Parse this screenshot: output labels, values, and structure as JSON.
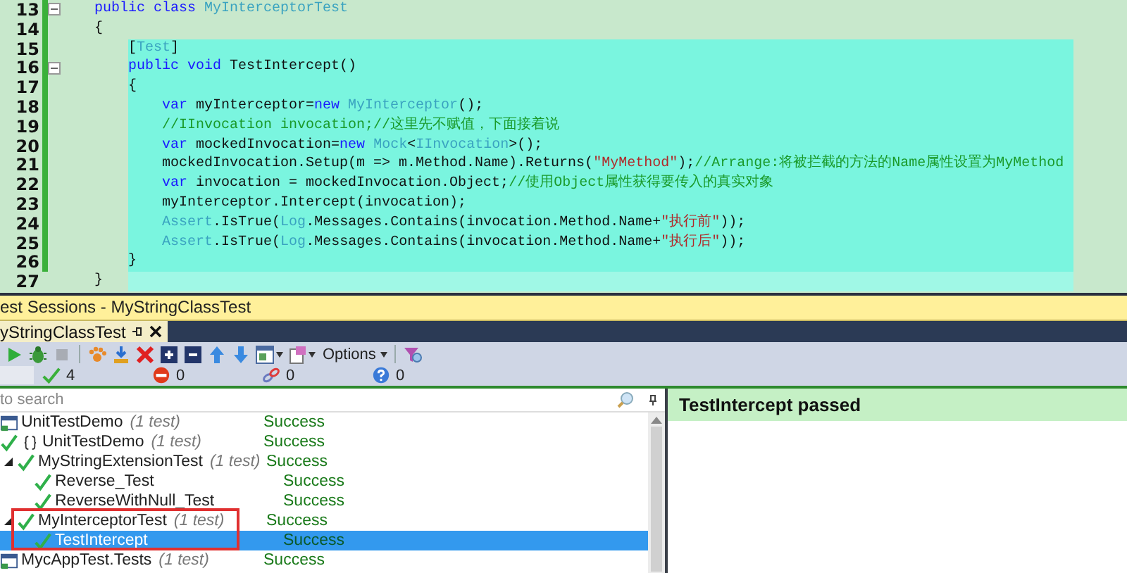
{
  "editor": {
    "lines": [
      {
        "number": "13",
        "fold": true,
        "changed": true,
        "selected": false,
        "current": false,
        "tokens": [
          {
            "kind": "keyword",
            "text": "    public "
          },
          {
            "kind": "keyword",
            "text": "class "
          },
          {
            "kind": "type",
            "text": "MyInterceptorTest"
          }
        ]
      },
      {
        "number": "14",
        "fold": false,
        "changed": true,
        "selected": false,
        "current": false,
        "tokens": [
          {
            "kind": "plain",
            "text": "    {"
          }
        ]
      },
      {
        "number": "15",
        "fold": false,
        "changed": true,
        "selected": true,
        "current": false,
        "tokens": [
          {
            "kind": "plain",
            "text": "        ["
          },
          {
            "kind": "type",
            "text": "Test"
          },
          {
            "kind": "plain",
            "text": "]"
          }
        ]
      },
      {
        "number": "16",
        "fold": true,
        "changed": true,
        "selected": true,
        "current": false,
        "tokens": [
          {
            "kind": "keyword",
            "text": "        public "
          },
          {
            "kind": "keyword",
            "text": "void"
          },
          {
            "kind": "plain",
            "text": " TestIntercept()"
          }
        ]
      },
      {
        "number": "17",
        "fold": false,
        "changed": true,
        "selected": true,
        "current": false,
        "tokens": [
          {
            "kind": "plain",
            "text": "        {"
          }
        ]
      },
      {
        "number": "18",
        "fold": false,
        "changed": true,
        "selected": true,
        "current": false,
        "tokens": [
          {
            "kind": "keyword",
            "text": "            var"
          },
          {
            "kind": "plain",
            "text": " myInterceptor="
          },
          {
            "kind": "keyword",
            "text": "new "
          },
          {
            "kind": "type",
            "text": "MyInterceptor"
          },
          {
            "kind": "plain",
            "text": "();"
          }
        ]
      },
      {
        "number": "19",
        "fold": false,
        "changed": true,
        "selected": true,
        "current": false,
        "tokens": [
          {
            "kind": "comment",
            "text": "            //IInvocation invocation;//这里先不赋值，下面接着说"
          }
        ]
      },
      {
        "number": "20",
        "fold": false,
        "changed": true,
        "selected": true,
        "current": false,
        "tokens": [
          {
            "kind": "keyword",
            "text": "            var"
          },
          {
            "kind": "plain",
            "text": " mockedInvocation="
          },
          {
            "kind": "keyword",
            "text": "new "
          },
          {
            "kind": "type",
            "text": "Mock"
          },
          {
            "kind": "plain",
            "text": "<"
          },
          {
            "kind": "type",
            "text": "IInvocation"
          },
          {
            "kind": "plain",
            "text": ">();"
          }
        ]
      },
      {
        "number": "21",
        "fold": false,
        "changed": true,
        "selected": true,
        "current": false,
        "tokens": [
          {
            "kind": "plain",
            "text": "            mockedInvocation.Setup(m => m.Method.Name).Returns("
          },
          {
            "kind": "string",
            "text": "\"MyMethod\""
          },
          {
            "kind": "plain",
            "text": ");"
          },
          {
            "kind": "comment",
            "text": "//Arrange:将被拦截的方法的Name属性设置为MyMethod"
          }
        ]
      },
      {
        "number": "22",
        "fold": false,
        "changed": true,
        "selected": true,
        "current": false,
        "tokens": [
          {
            "kind": "keyword",
            "text": "            var"
          },
          {
            "kind": "plain",
            "text": " invocation = mockedInvocation.Object;"
          },
          {
            "kind": "comment",
            "text": "//使用Object属性获得要传入的真实对象"
          }
        ]
      },
      {
        "number": "23",
        "fold": false,
        "changed": true,
        "selected": true,
        "current": false,
        "tokens": [
          {
            "kind": "plain",
            "text": "            myInterceptor.Intercept(invocation);"
          }
        ]
      },
      {
        "number": "24",
        "fold": false,
        "changed": true,
        "selected": true,
        "current": false,
        "tokens": [
          {
            "kind": "type",
            "text": "            Assert"
          },
          {
            "kind": "plain",
            "text": ".IsTrue("
          },
          {
            "kind": "type",
            "text": "Log"
          },
          {
            "kind": "plain",
            "text": ".Messages.Contains(invocation.Method.Name+"
          },
          {
            "kind": "string",
            "text": "\"执行前\""
          },
          {
            "kind": "plain",
            "text": "));"
          }
        ]
      },
      {
        "number": "25",
        "fold": false,
        "changed": true,
        "selected": true,
        "current": false,
        "tokens": [
          {
            "kind": "type",
            "text": "            Assert"
          },
          {
            "kind": "plain",
            "text": ".IsTrue("
          },
          {
            "kind": "type",
            "text": "Log"
          },
          {
            "kind": "plain",
            "text": ".Messages.Contains(invocation.Method.Name+"
          },
          {
            "kind": "string",
            "text": "\"执行后\""
          },
          {
            "kind": "plain",
            "text": "));"
          }
        ]
      },
      {
        "number": "26",
        "fold": false,
        "changed": true,
        "selected": true,
        "current": false,
        "tokens": [
          {
            "kind": "plain",
            "text": "        }"
          }
        ]
      },
      {
        "number": "27",
        "fold": false,
        "changed": false,
        "selected": false,
        "current": true,
        "tokens": [
          {
            "kind": "plain",
            "text": "    }"
          }
        ]
      }
    ]
  },
  "panel": {
    "title": "est Sessions - MyStringClassTest",
    "tab": {
      "label": "yStringClassTest",
      "selected": true
    },
    "toolbar": [
      {
        "kind": "run"
      },
      {
        "kind": "debug"
      },
      {
        "kind": "stop"
      },
      {
        "kind": "separator"
      },
      {
        "kind": "paw"
      },
      {
        "kind": "download"
      },
      {
        "kind": "delete"
      },
      {
        "kind": "expand"
      },
      {
        "kind": "collapse"
      },
      {
        "kind": "up"
      },
      {
        "kind": "down"
      },
      {
        "kind": "layout",
        "dropdown": true
      },
      {
        "kind": "page",
        "dropdown": true
      },
      {
        "kind": "menu",
        "label": "Options",
        "dropdown": true
      },
      {
        "kind": "separator"
      },
      {
        "kind": "filter"
      }
    ],
    "counts": [
      {
        "kind": "passed",
        "count": "4"
      },
      {
        "kind": "failed",
        "count": "0"
      },
      {
        "kind": "ignored",
        "count": "0"
      },
      {
        "kind": "unknown",
        "count": "0"
      }
    ],
    "search": {
      "placeholder": "to search"
    },
    "tree": [
      {
        "kind": "project",
        "name": "UnitTestDemo",
        "count": "(1 test)",
        "status": "Success",
        "selected": false,
        "children": [
          {
            "kind": "namespace",
            "name": "UnitTestDemo",
            "count": "(1 test)",
            "status": "Success",
            "selected": false,
            "children": [
              {
                "kind": "class",
                "name": "MyStringExtensionTest",
                "count": "(1 test)",
                "status": "Success",
                "selected": false,
                "expanded": true,
                "children": [
                  {
                    "kind": "test",
                    "name": "Reverse_Test",
                    "status": "Success",
                    "selected": false
                  },
                  {
                    "kind": "test",
                    "name": "ReverseWithNull_Test",
                    "status": "Success",
                    "selected": false
                  }
                ]
              },
              {
                "kind": "class",
                "name": "MyInterceptorTest",
                "count": "(1 test)",
                "status": "Success",
                "selected": false,
                "expanded": true,
                "children": [
                  {
                    "kind": "test",
                    "name": "TestIntercept",
                    "status": "Success",
                    "selected": true
                  }
                ]
              }
            ]
          }
        ]
      },
      {
        "kind": "project",
        "name": "MycAppTest.Tests",
        "count": "(1 test)",
        "status": "Success",
        "selected": false
      }
    ],
    "result": {
      "title": "TestIntercept passed"
    }
  }
}
